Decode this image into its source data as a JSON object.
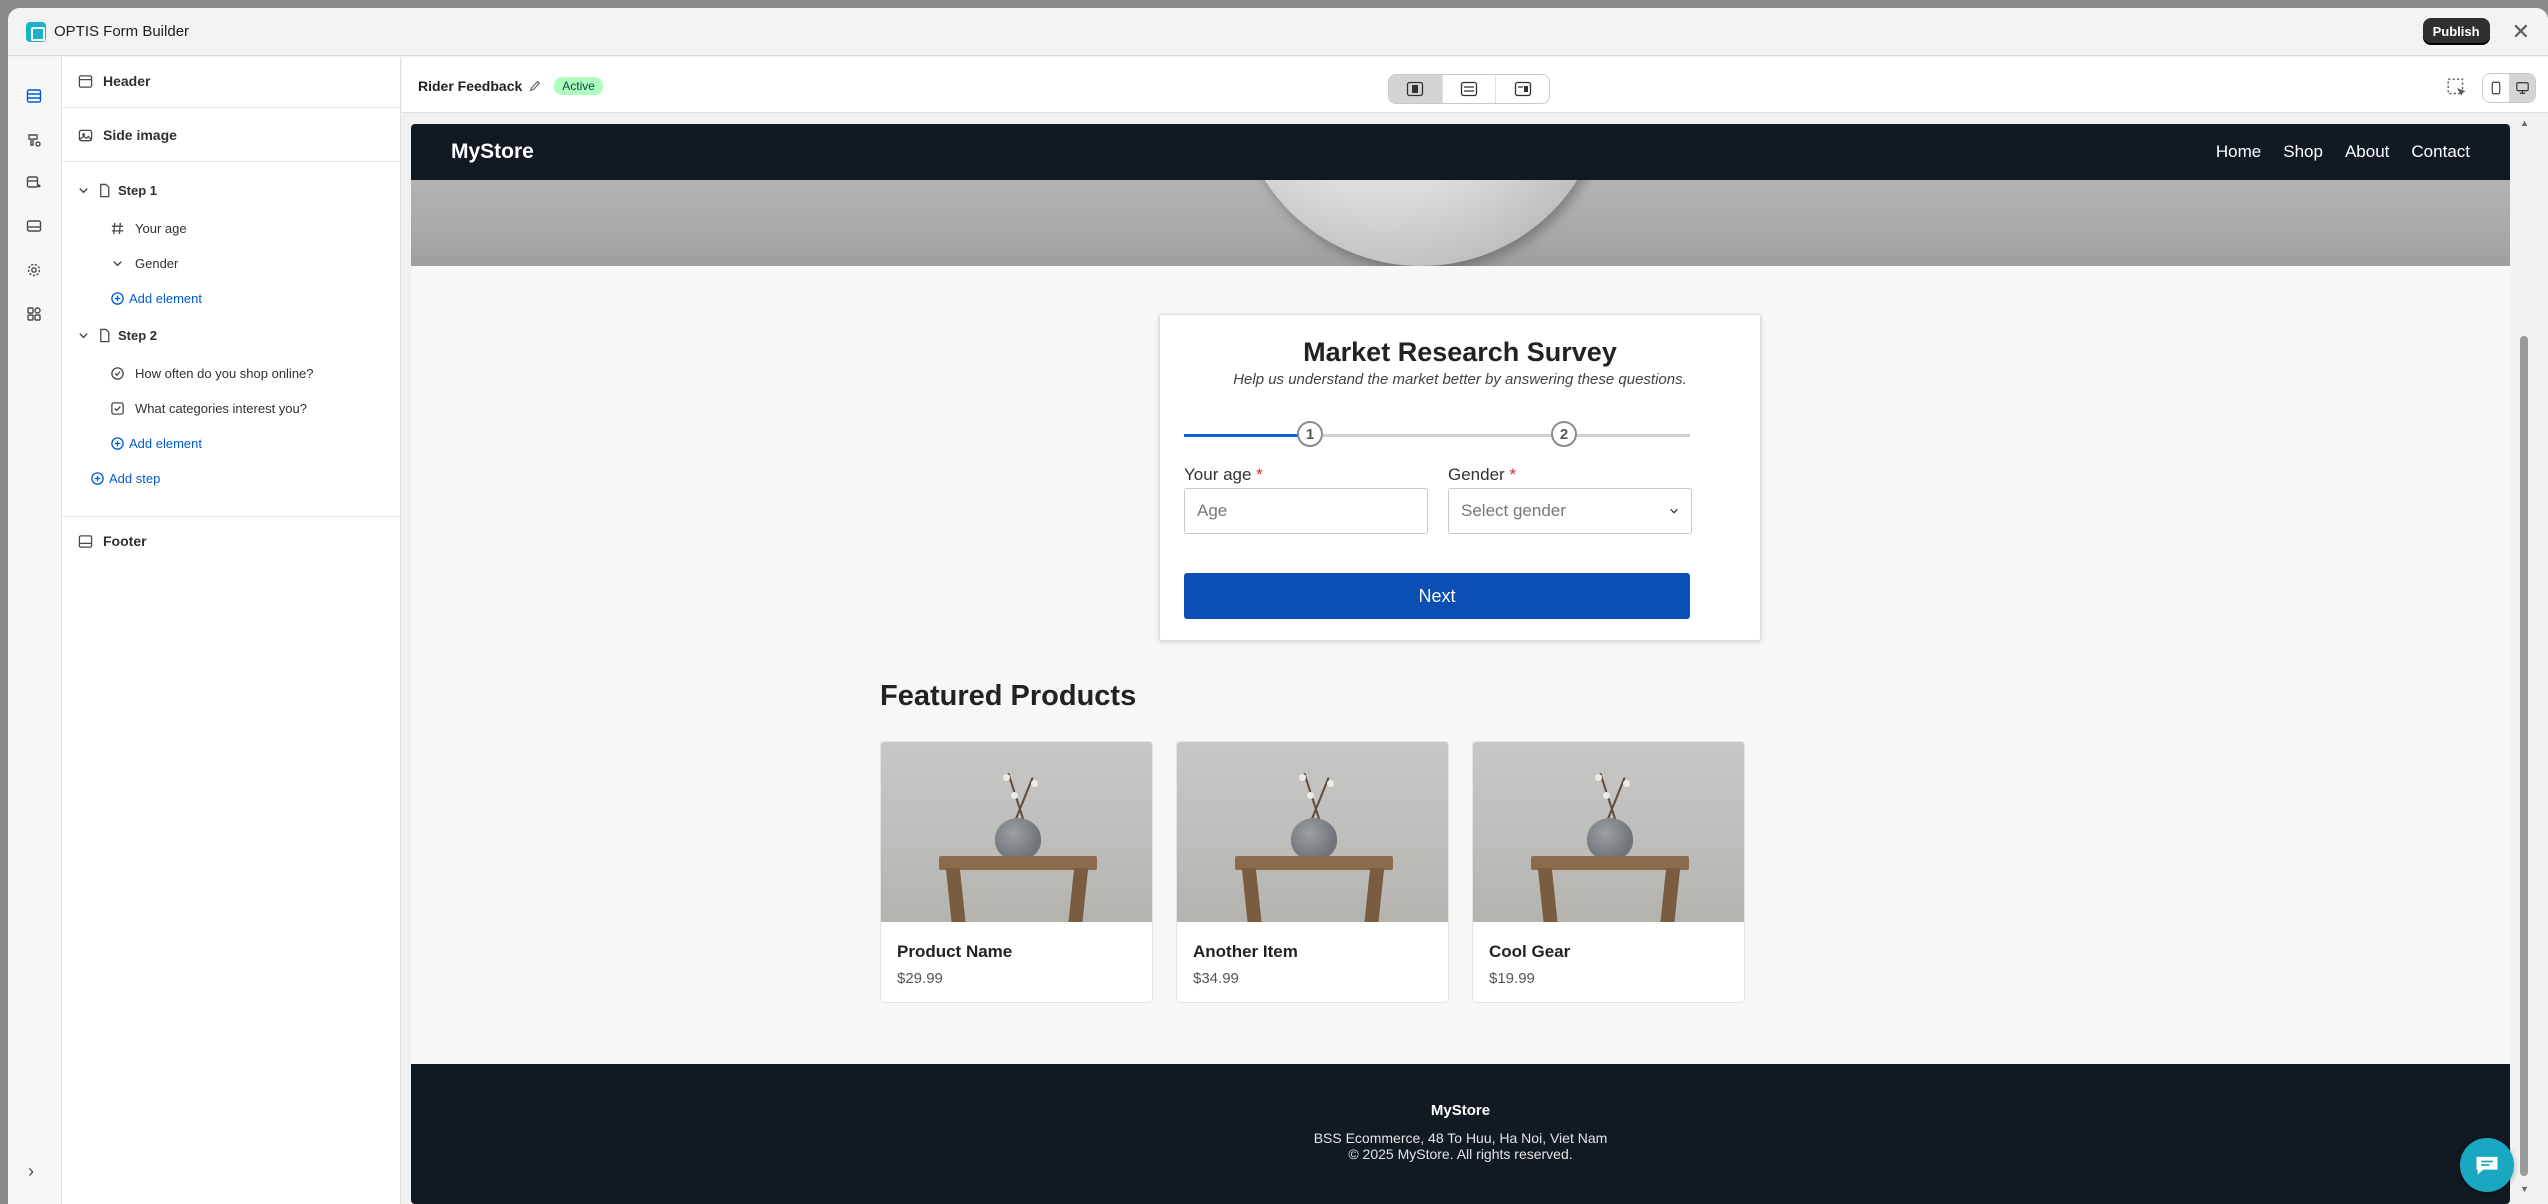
{
  "app": {
    "title": "OPTIS Form Builder",
    "publish_label": "Publish",
    "close_glyph": "✕"
  },
  "rail": {
    "icons": [
      "layout-icon",
      "paint-icon",
      "integration-icon",
      "email-icon",
      "settings-icon",
      "apps-icon"
    ],
    "expand_glyph": "›"
  },
  "panel": {
    "header_label": "Header",
    "side_image_label": "Side image",
    "steps": [
      {
        "label": "Step 1",
        "elements": [
          {
            "label": "Your age",
            "icon": "hash-icon"
          },
          {
            "label": "Gender",
            "icon": "chevron-down-icon"
          }
        ],
        "add_element": "Add element"
      },
      {
        "label": "Step 2",
        "elements": [
          {
            "label": "How often do you shop online?",
            "icon": "radio-icon"
          },
          {
            "label": "What categories interest you?",
            "icon": "checkbox-icon"
          }
        ],
        "add_element": "Add element"
      }
    ],
    "add_step": "Add step",
    "footer_label": "Footer"
  },
  "editor": {
    "form_name": "Rider Feedback",
    "status_badge": "Active"
  },
  "site": {
    "brand": "MyStore",
    "nav": [
      "Home",
      "Shop",
      "About",
      "Contact"
    ],
    "survey": {
      "title": "Market Research Survey",
      "subtitle": "Help us understand the market better by answering these questions.",
      "steps": [
        "1",
        "2"
      ],
      "progress_fraction": 0.25,
      "age_label": "Your age",
      "age_placeholder": "Age",
      "gender_label": "Gender",
      "gender_placeholder": "Select gender",
      "required_mark": "*",
      "next_label": "Next"
    },
    "featured_title": "Featured Products",
    "products": [
      {
        "name": "Product Name",
        "price": "$29.99"
      },
      {
        "name": "Another Item",
        "price": "$34.99"
      },
      {
        "name": "Cool Gear",
        "price": "$19.99"
      }
    ],
    "footer": {
      "brand": "MyStore",
      "address": "BSS Ecommerce, 48 To Huu, Ha Noi, Viet Nam",
      "copyright": "© 2025 MyStore. All rights reserved."
    }
  },
  "colors": {
    "accent": "#005bd3",
    "brand": "#1ab2c9",
    "nav_bg": "#111a22",
    "button": "#0b4eb4",
    "badge_bg": "#affebf"
  }
}
